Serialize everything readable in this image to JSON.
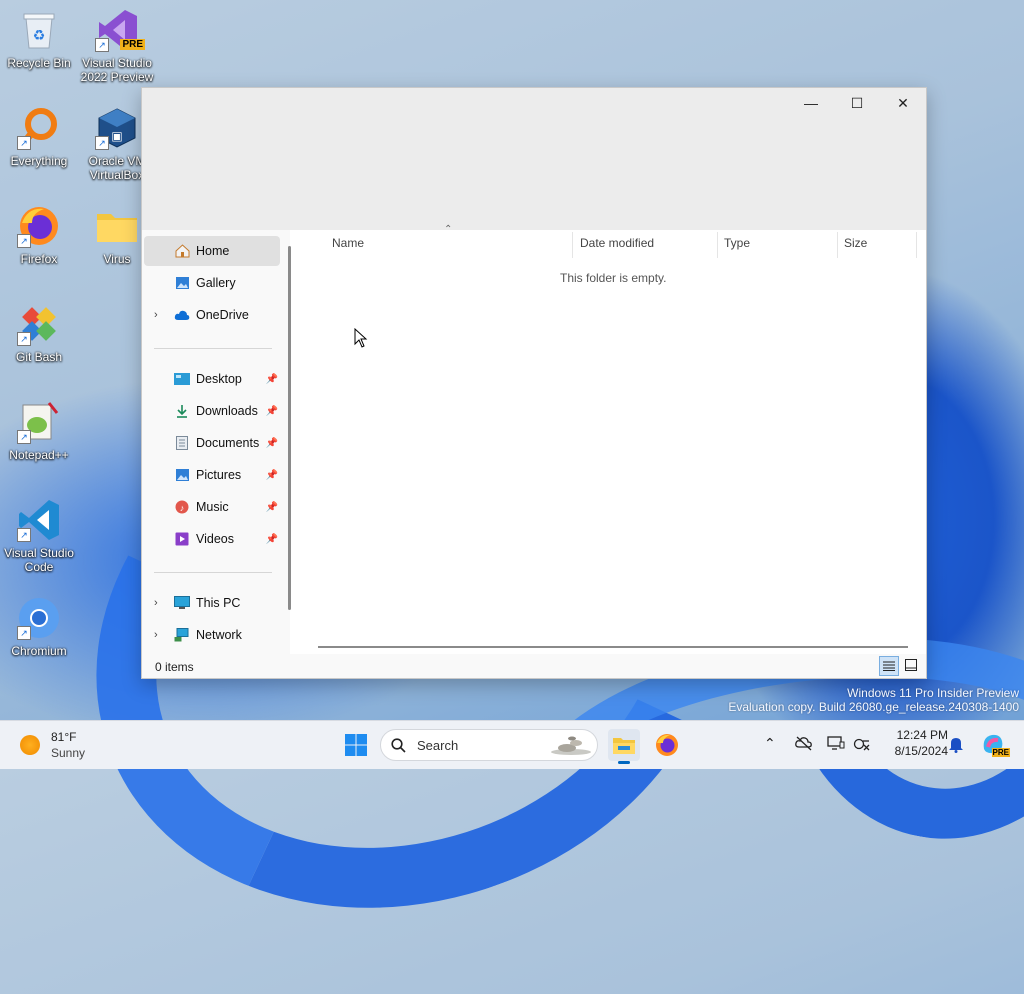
{
  "desktop": {
    "icons": [
      {
        "label": "Recycle Bin"
      },
      {
        "label": "Visual Studio 2022 Preview",
        "badge": "PRE"
      },
      {
        "label": "Everything"
      },
      {
        "label": "Oracle VM VirtualBox"
      },
      {
        "label": "Firefox"
      },
      {
        "label": "Virus"
      },
      {
        "label": "Git Bash"
      },
      {
        "label": "Notepad++"
      },
      {
        "label": "Visual Studio Code"
      },
      {
        "label": "Chromium"
      }
    ]
  },
  "explorer": {
    "window_controls": {
      "minimize": "—",
      "maximize": "☐",
      "close": "✕"
    },
    "nav": {
      "home": "Home",
      "gallery": "Gallery",
      "onedrive": "OneDrive",
      "desktop": "Desktop",
      "downloads": "Downloads",
      "documents": "Documents",
      "pictures": "Pictures",
      "music": "Music",
      "videos": "Videos",
      "this_pc": "This PC",
      "network": "Network"
    },
    "columns": {
      "name": "Name",
      "date_modified": "Date modified",
      "type": "Type",
      "size": "Size"
    },
    "empty_message": "This folder is empty.",
    "status": {
      "items": "0 items"
    }
  },
  "taskbar": {
    "weather": {
      "temp": "81°F",
      "condition": "Sunny"
    },
    "search_placeholder": "Search",
    "clock": {
      "time": "12:24 PM",
      "date": "8/15/2024"
    },
    "copilot_badge": "PRE"
  },
  "watermark": {
    "line1": "Windows 11 Pro Insider Preview",
    "line2": "Evaluation copy. Build 26080.ge_release.240308-1400"
  },
  "colors": {
    "accent": "#0067c0",
    "nav_selected": "#e0e0e0"
  }
}
